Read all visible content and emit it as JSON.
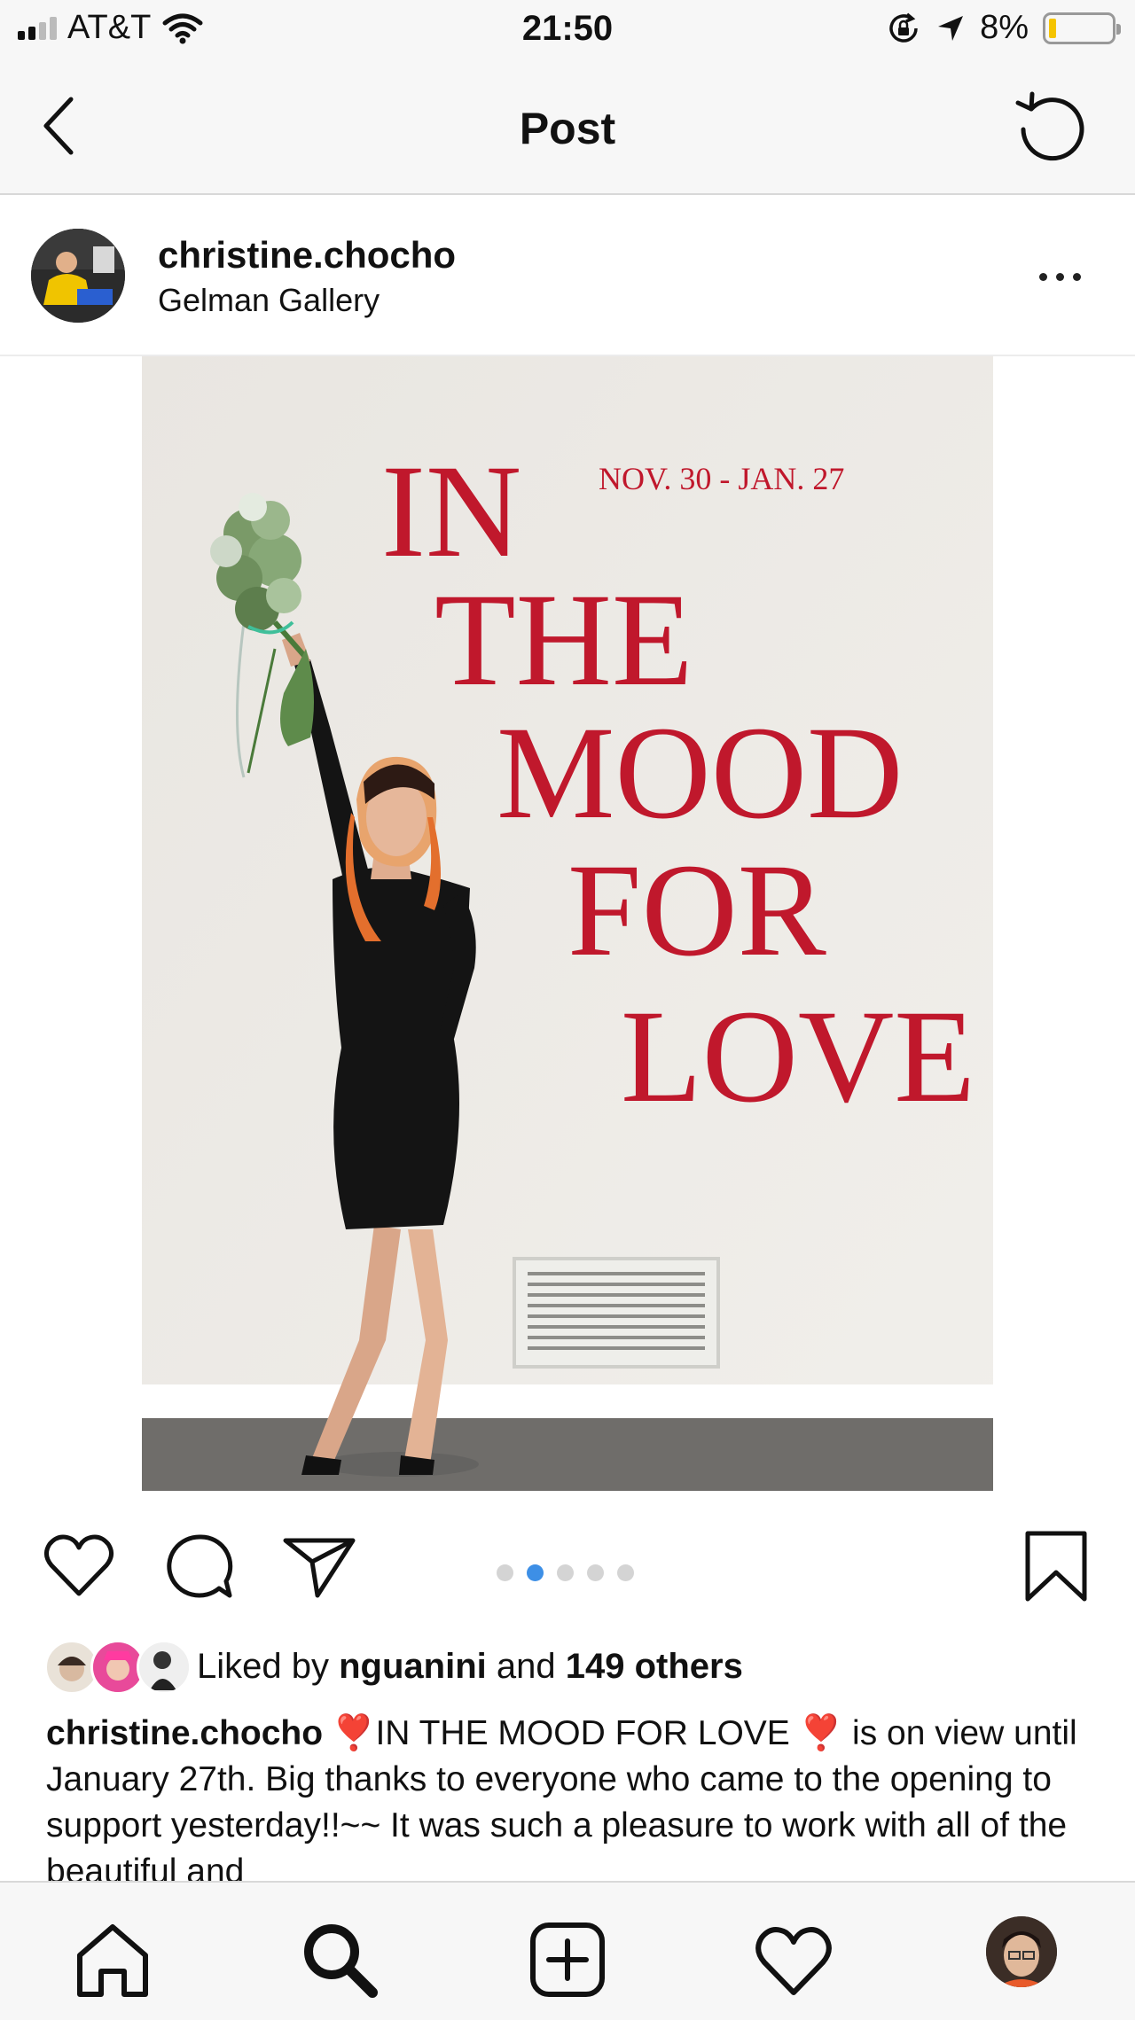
{
  "status_bar": {
    "carrier": "AT&T",
    "time": "21:50",
    "battery": "8%",
    "battery_level": 0.08
  },
  "nav": {
    "title": "Post"
  },
  "post": {
    "username": "christine.chocho",
    "location": "Gelman Gallery",
    "image": {
      "wall_title_lines": [
        "IN",
        "THE",
        "MOOD",
        "FOR",
        "LOVE"
      ],
      "wall_dates": "NOV. 30 - JAN. 27"
    },
    "carousel": {
      "count": 5,
      "active_index": 1
    },
    "likes": {
      "prefix": "Liked by ",
      "user": "nguanini",
      "middle": " and ",
      "count": "149 others"
    },
    "caption": {
      "username": "christine.chocho",
      "emoji": "❣️",
      "part1": "IN THE MOOD FOR LOVE",
      "part2": " is on view until January 27th. Big thanks to everyone who came to the opening to support yesterday!!~~ It was such a pleasure to work with all of the beautiful and"
    }
  },
  "tabbar": {
    "items": [
      "home-icon",
      "search-icon",
      "new-post-icon",
      "activity-heart-icon",
      "profile-avatar"
    ]
  },
  "colors": {
    "accent": "#3d8fe6",
    "wall_text": "#c0182c",
    "battery": "#f5c400"
  }
}
